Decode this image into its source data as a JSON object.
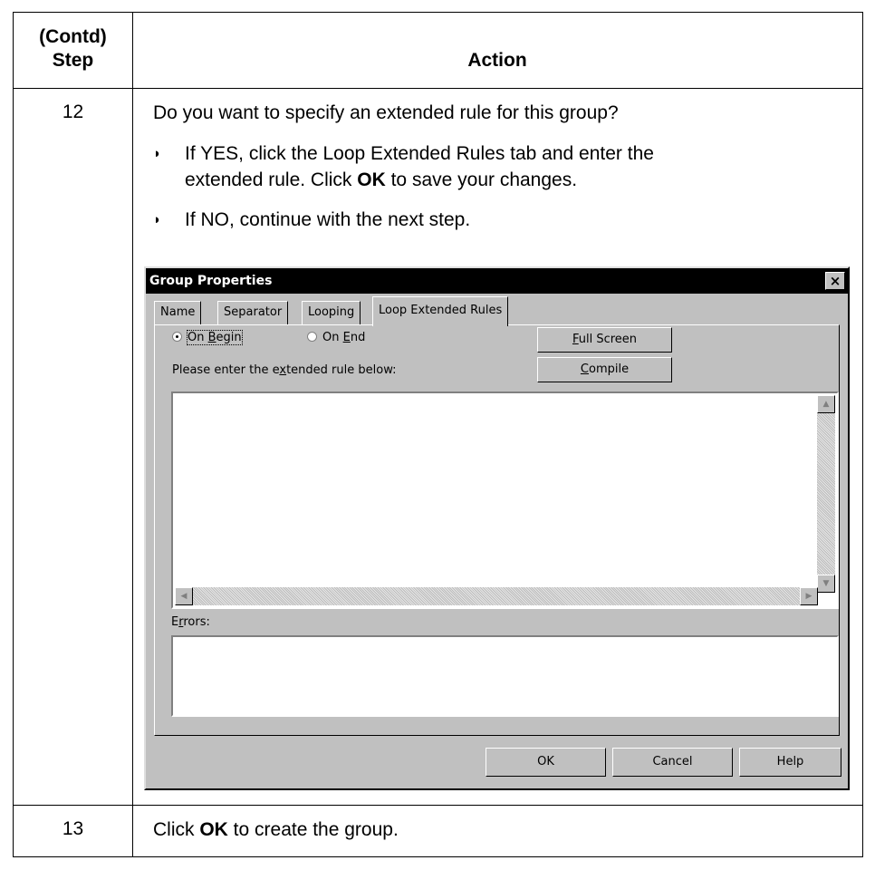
{
  "table": {
    "header": {
      "step": "(Contd) Step",
      "step_line1": "(Contd)",
      "step_line2": "Step",
      "action": "Action"
    },
    "rows": [
      {
        "step": "12",
        "question": "Do you want to specify an extended rule for this group?",
        "bullets": [
          {
            "line1": "If YES, click the Loop Extended Rules tab and enter the",
            "line2_pre": "extended rule. Click ",
            "line2_bold": "OK",
            "line2_post": " to save your changes."
          },
          {
            "line1": "If NO, continue with the next step."
          }
        ],
        "bullet_glyph": "◗"
      },
      {
        "step": "13",
        "text_pre": "Click ",
        "text_bold": "OK",
        "text_post": " to create the group."
      }
    ]
  },
  "dialog": {
    "title": "Group Properties",
    "close_glyph": "×",
    "tabs": [
      {
        "label": "Name",
        "active": false
      },
      {
        "label": "Separator",
        "active": false
      },
      {
        "label": "Looping",
        "active": false
      },
      {
        "label": "Loop Extended Rules",
        "active": true
      }
    ],
    "radios": [
      {
        "label_pre": "On ",
        "label_u": "B",
        "label_post": "egin",
        "checked": true
      },
      {
        "label_pre": "On ",
        "label_u": "E",
        "label_post": "nd",
        "checked": false
      }
    ],
    "full_screen": {
      "u": "F",
      "rest": "ull Screen"
    },
    "compile": {
      "u": "C",
      "rest": "ompile"
    },
    "rule_prompt": {
      "pre": "Please enter the e",
      "u": "x",
      "post": "tended rule below:"
    },
    "rule_text": "",
    "errors_label": {
      "pre": "E",
      "u": "r",
      "post": "rors:"
    },
    "errors_text": "",
    "buttons": {
      "ok": "OK",
      "cancel": "Cancel",
      "help": "Help"
    },
    "scroll_glyphs": {
      "up": "▲",
      "down": "▼",
      "left": "◀",
      "right": "▶"
    }
  }
}
